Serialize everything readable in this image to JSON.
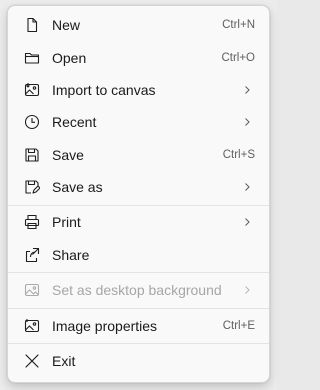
{
  "menu": {
    "items": [
      {
        "label": "New",
        "shortcut": "Ctrl+N",
        "icon": "new-file-icon",
        "submenu": false,
        "enabled": true
      },
      {
        "label": "Open",
        "shortcut": "Ctrl+O",
        "icon": "folder-icon",
        "submenu": false,
        "enabled": true
      },
      {
        "label": "Import to canvas",
        "shortcut": "",
        "icon": "import-image-icon",
        "submenu": true,
        "enabled": true
      },
      {
        "label": "Recent",
        "shortcut": "",
        "icon": "clock-icon",
        "submenu": true,
        "enabled": true
      },
      {
        "label": "Save",
        "shortcut": "Ctrl+S",
        "icon": "save-icon",
        "submenu": false,
        "enabled": true
      },
      {
        "label": "Save as",
        "shortcut": "",
        "icon": "save-as-icon",
        "submenu": true,
        "enabled": true
      },
      {
        "label": "Print",
        "shortcut": "",
        "icon": "printer-icon",
        "submenu": true,
        "enabled": true
      },
      {
        "label": "Share",
        "shortcut": "",
        "icon": "share-icon",
        "submenu": false,
        "enabled": true
      },
      {
        "label": "Set as desktop background",
        "shortcut": "",
        "icon": "desktop-background-icon",
        "submenu": true,
        "enabled": false
      },
      {
        "label": "Image properties",
        "shortcut": "Ctrl+E",
        "icon": "image-properties-icon",
        "submenu": false,
        "enabled": true
      },
      {
        "label": "Exit",
        "shortcut": "",
        "icon": "close-icon",
        "submenu": false,
        "enabled": true
      }
    ]
  },
  "colors": {
    "menu_bg": "#f9f9f9",
    "text": "#1a1a1a",
    "shortcut_text": "#5f5f5f",
    "disabled_text": "#a6a6a6",
    "separator": "#e3e3e3"
  }
}
